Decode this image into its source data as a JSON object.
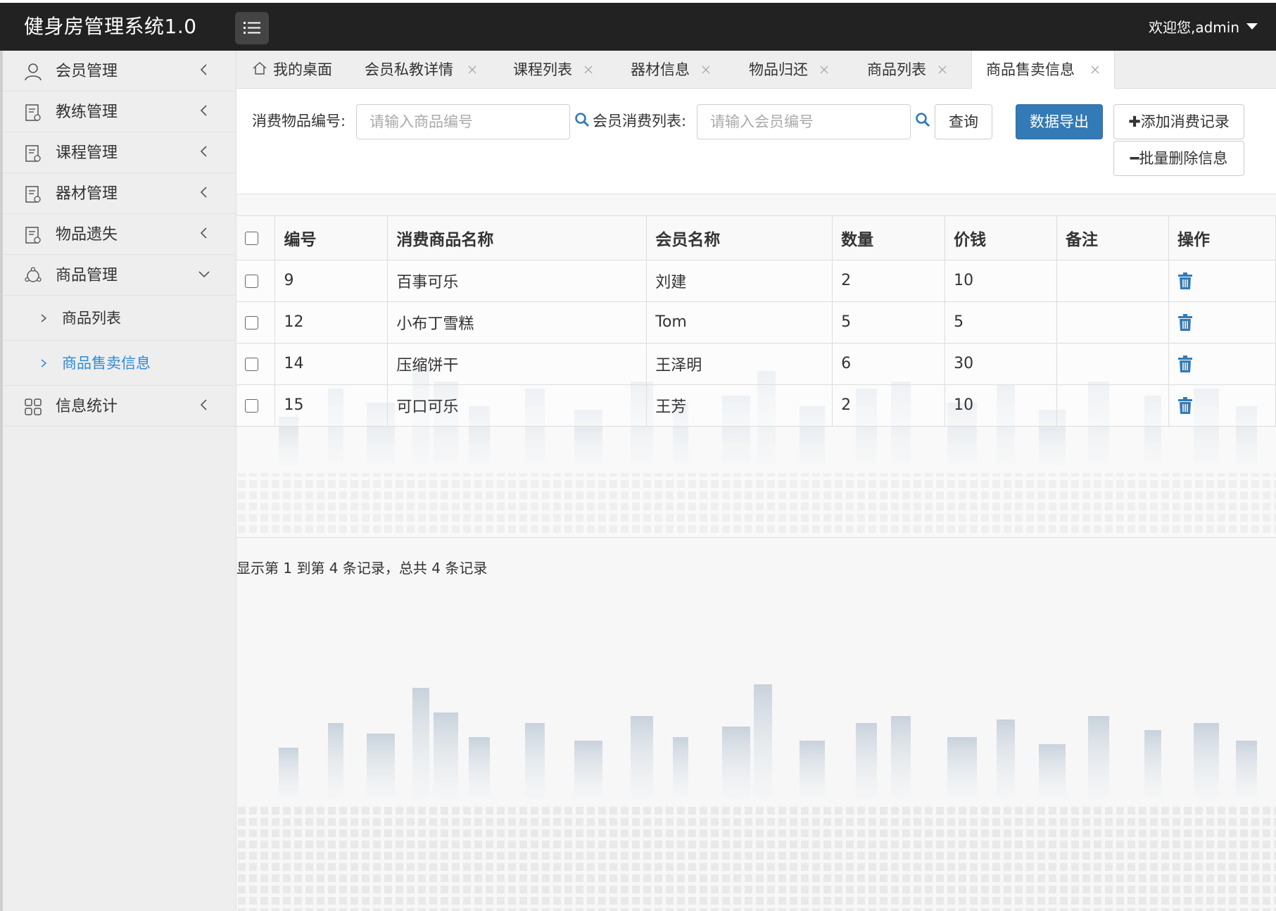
{
  "app": {
    "title": "健身房管理系统1.0",
    "welcome": "欢迎您,admin"
  },
  "sidebar": {
    "items": [
      {
        "label": "会员管理",
        "icon": "user-icon"
      },
      {
        "label": "教练管理",
        "icon": "document-icon"
      },
      {
        "label": "课程管理",
        "icon": "document-icon"
      },
      {
        "label": "器材管理",
        "icon": "document-icon"
      },
      {
        "label": "物品遗失",
        "icon": "document-icon"
      },
      {
        "label": "商品管理",
        "icon": "gear-icon"
      },
      {
        "label": "信息统计",
        "icon": "grid-icon"
      }
    ],
    "sub_items": [
      {
        "label": "商品列表"
      },
      {
        "label": "商品售卖信息"
      }
    ]
  },
  "tabs": [
    {
      "label": "我的桌面"
    },
    {
      "label": "会员私教详情"
    },
    {
      "label": "课程列表"
    },
    {
      "label": "器材信息"
    },
    {
      "label": "物品归还"
    },
    {
      "label": "商品列表"
    },
    {
      "label": "商品售卖信息"
    }
  ],
  "toolbar": {
    "item_id_label": "消费物品编号:",
    "item_id_placeholder": "请输入商品编号",
    "member_label": "会员消费列表:",
    "member_placeholder": "请输入会员编号",
    "query_label": "查询",
    "export_label": "数据导出",
    "add_label": "✚添加消费记录",
    "batch_delete_label": "━批量删除信息"
  },
  "table": {
    "headers": [
      "编号",
      "消费商品名称",
      "会员名称",
      "数量",
      "价钱",
      "备注",
      "操作"
    ],
    "rows": [
      {
        "id": "9",
        "product": "百事可乐",
        "member": "刘建",
        "qty": "2",
        "price": "10",
        "note": ""
      },
      {
        "id": "12",
        "product": "小布丁雪糕",
        "member": "Tom",
        "qty": "5",
        "price": "5",
        "note": ""
      },
      {
        "id": "14",
        "product": "压缩饼干",
        "member": "王泽明",
        "qty": "6",
        "price": "30",
        "note": ""
      },
      {
        "id": "15",
        "product": "可口可乐",
        "member": "王芳",
        "qty": "2",
        "price": "10",
        "note": ""
      }
    ]
  },
  "summary": "显示第 1 到第 4 条记录，总共 4 条记录",
  "colors": {
    "topbar": "#222222",
    "accent": "#337ab7",
    "active_link": "#2f8ad6",
    "sidebar_bg": "#eeeeee"
  }
}
